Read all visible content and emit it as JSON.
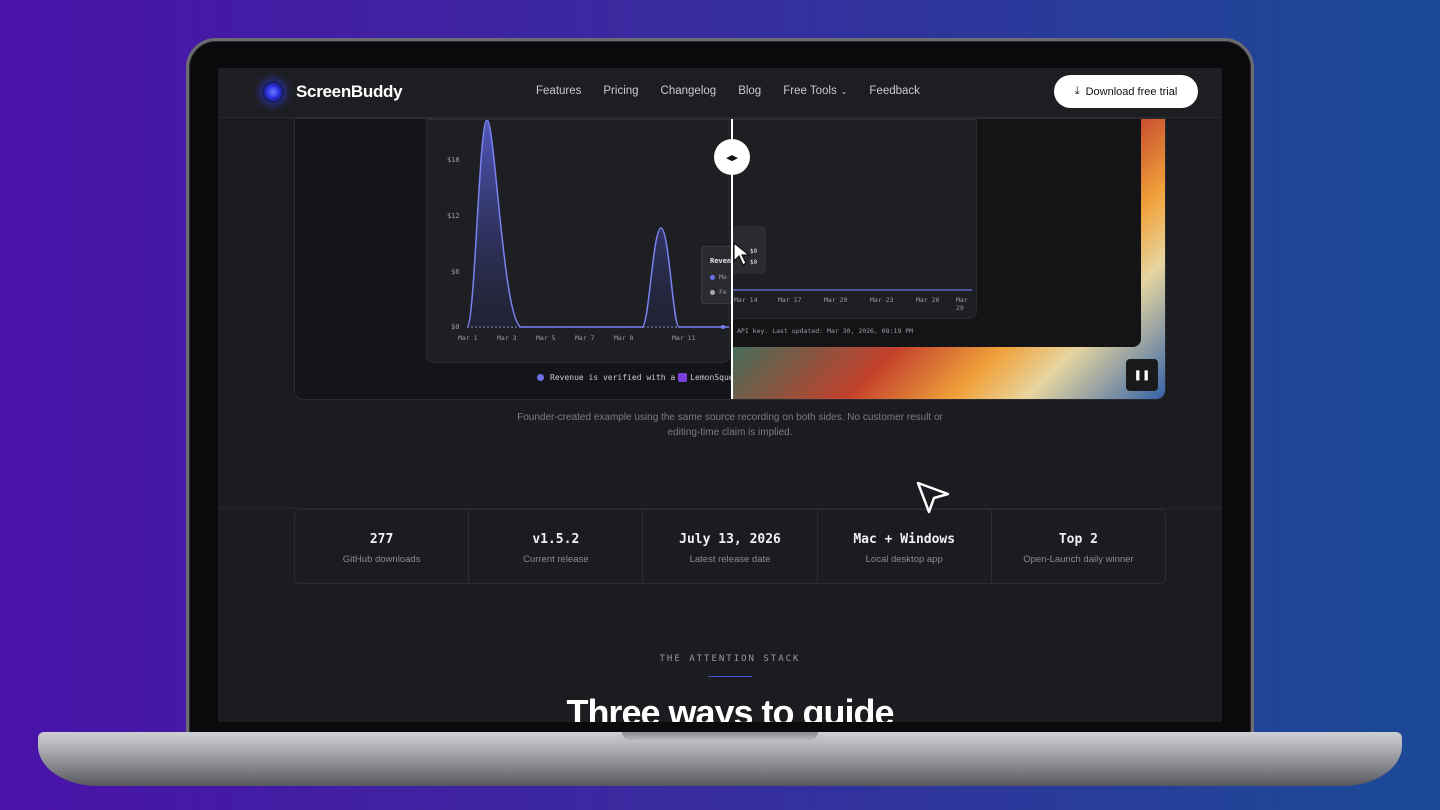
{
  "nav": {
    "brand": "ScreenBuddy",
    "links": [
      "Features",
      "Pricing",
      "Changelog",
      "Blog",
      "Free Tools",
      "Feedback"
    ],
    "cta": "Download free trial"
  },
  "demo": {
    "y_ticks": [
      "$18",
      "$12",
      "$6",
      "$0"
    ],
    "x_ticks_left": [
      "Mar 1",
      "Mar 3",
      "Mar 5",
      "Mar 7",
      "Mar 8",
      "Mar 11"
    ],
    "x_ticks_right": [
      "Mar 14",
      "Mar 17",
      "Mar 20",
      "Mar 23",
      "Mar 26",
      "Mar 29"
    ],
    "tooltip_title": "Reven",
    "tooltip_items": [
      "Ma",
      "Fe"
    ],
    "tooltip_values": [
      "$0",
      "$0"
    ],
    "footer_left": "Revenue is verified with a",
    "footer_brand": "LemonSqueez",
    "footer_right": "API key. Last updated: Mar 30, 2026, 08:19 PM",
    "handle_icon": "◂▸",
    "pause_icon": "❚❚"
  },
  "caption": {
    "line1": "Founder-created example using the same source recording on both sides. No customer result or",
    "line2": "editing-time claim is implied."
  },
  "stats": [
    {
      "value": "277",
      "label": "GitHub downloads"
    },
    {
      "value": "v1.5.2",
      "label": "Current release"
    },
    {
      "value": "July 13, 2026",
      "label": "Latest release date"
    },
    {
      "value": "Mac + Windows",
      "label": "Local desktop app"
    },
    {
      "value": "Top 2",
      "label": "Open-Launch daily winner"
    }
  ],
  "section": {
    "eyebrow": "THE ATTENTION STACK",
    "headline": "Three ways to guide"
  }
}
